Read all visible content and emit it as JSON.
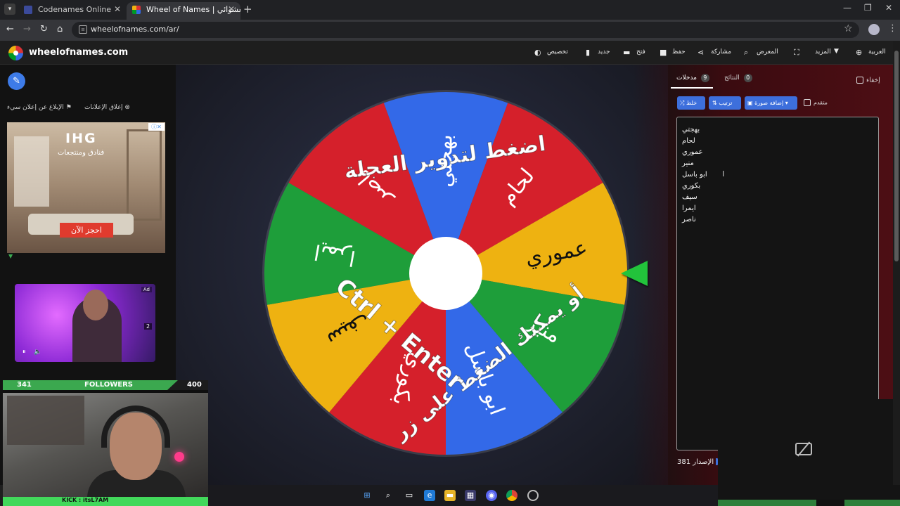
{
  "browser": {
    "tabs": [
      {
        "title": "Codenames Online",
        "favicon_color": "#3b4a9a"
      },
      {
        "title": "Wheel of Names | اسم العشوائي",
        "favicon_color": "#db3236"
      }
    ],
    "url": "wheelofnames.com/ar/"
  },
  "site": {
    "brand": "wheelofnames.com",
    "nav": {
      "customize": "تخصيص",
      "new": "جديد",
      "open": "فتح",
      "save": "حفظ",
      "share": "مشاركة",
      "gallery": "المعرض",
      "more": "المزيد",
      "language": "العربية"
    }
  },
  "ads": {
    "report_ad": "الإبلاغ عن إعلان سيء",
    "close_ads": "إغلاق الإعلانات",
    "ihg": {
      "brand": "IHG",
      "subtitle": "فنادق ومنتجعات",
      "cta": "احجز الآن"
    },
    "video": {
      "label": "Ad",
      "count": "2"
    }
  },
  "stream_overlay": {
    "followers_current": "341",
    "followers_label": "FOLLOWERS",
    "followers_goal": "400",
    "followers_progress": 0.8525,
    "kick_handle": "KICK : itsL7AM"
  },
  "wheel": {
    "segments": [
      {
        "name": "بهجتي",
        "color": "#3369e8"
      },
      {
        "name": "لحام",
        "color": "#d5202b"
      },
      {
        "name": "عموري",
        "color": "#eeb211"
      },
      {
        "name": "منير",
        "color": "#1e9e3a"
      },
      {
        "name": "ابو باسل",
        "color": "#3369e8"
      },
      {
        "name": "بكوري",
        "color": "#d5202b"
      },
      {
        "name": "سيف",
        "color": "#eeb211"
      },
      {
        "name": "ايمرا",
        "color": "#1e9e3a"
      },
      {
        "name": "ناصر",
        "color": "#d5202b"
      }
    ],
    "overlay_lines": [
      "اضغط لتدوير العجلة",
      "أو يمكنك الضغط على زر",
      "Ctrl + Enter"
    ]
  },
  "panel": {
    "tab_entries": "مدخلات",
    "entries_count": "9",
    "tab_results": "النتائج",
    "results_count": "0",
    "hide": "إخفاء",
    "shuffle": "خلط",
    "sort": "ترتيب",
    "add_image": "إضافة صورة",
    "advanced": "متقدم",
    "entries": [
      "بهجتي",
      "لحام",
      "عموري",
      "منير",
      "ابو باسل",
      "بكوري",
      "سيف",
      "ايمرا",
      "ناصر"
    ],
    "version_label": "الإصدار",
    "version_number": "381"
  },
  "colors": {
    "accent": "#3d6fdc",
    "wheel_red": "#d5202b",
    "wheel_blue": "#3369e8",
    "wheel_yellow": "#eeb211",
    "wheel_green": "#1e9e3a"
  }
}
